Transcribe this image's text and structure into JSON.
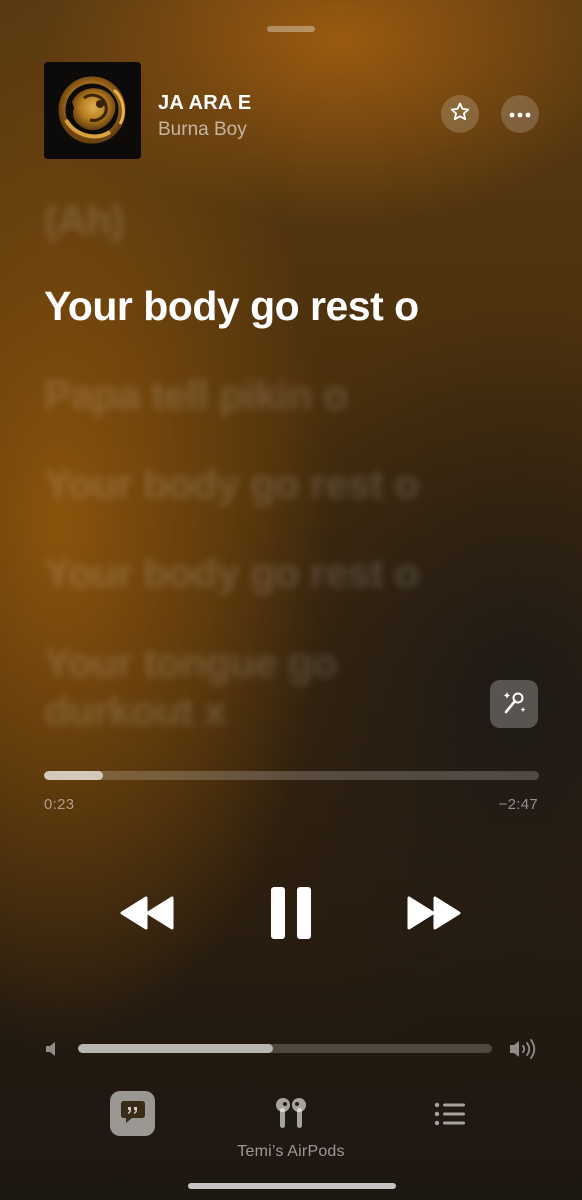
{
  "now_playing": {
    "title": "JA ARA E",
    "artist": "Burna Boy"
  },
  "lyrics": {
    "lines": [
      {
        "text": "(Ah)",
        "state": "past"
      },
      {
        "text": "Your body go rest o",
        "state": "active"
      },
      {
        "text": "Papa tell pikin o",
        "state": "upcoming"
      },
      {
        "text": "Your body go rest o",
        "state": "upcoming"
      },
      {
        "text": "Your body go rest o",
        "state": "upcoming"
      },
      {
        "text": "Your tongue go",
        "state": "upcoming"
      },
      {
        "text": "durkout x",
        "state": "upcoming"
      }
    ]
  },
  "playback": {
    "elapsed": "0:23",
    "remaining": "−2:47",
    "progress_fraction": 0.12,
    "state": "playing"
  },
  "volume": {
    "level_fraction": 0.47
  },
  "output": {
    "device_name": "Temi’s AirPods"
  },
  "icons": {
    "favorite": "star-icon",
    "more": "ellipsis-icon",
    "sing": "microphone-sparkle-icon",
    "rewind": "rewind-icon",
    "pause": "pause-icon",
    "forward": "fast-forward-icon",
    "volume_low": "speaker-low-icon",
    "volume_high": "speaker-high-icon",
    "lyrics": "quote-bubble-icon",
    "airplay": "airpods-icon",
    "queue": "list-icon"
  },
  "colors": {
    "accent_warm": "#8a530c",
    "background_dark": "#1e1812"
  }
}
